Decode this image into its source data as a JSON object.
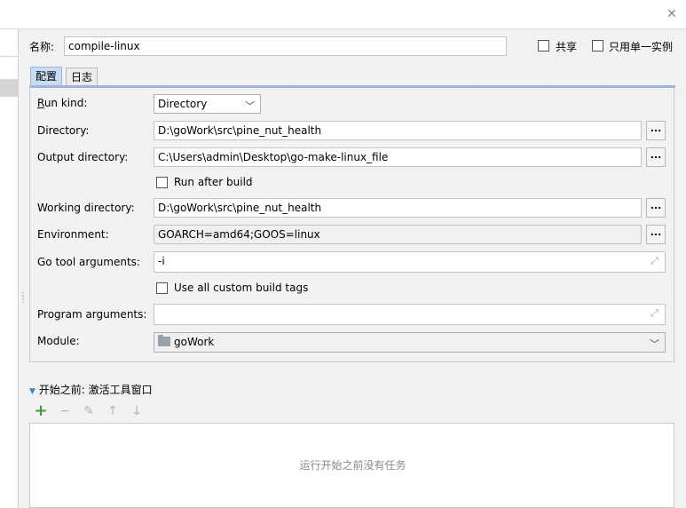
{
  "header": {
    "name_label": "名称:",
    "name_value": "compile-linux",
    "share_label": "共享",
    "single_instance_label": "只用单一实例"
  },
  "tabs": [
    {
      "label": "配置",
      "active": true
    },
    {
      "label": "日志",
      "active": false
    }
  ],
  "form": {
    "run_kind": {
      "label": "Run kind:",
      "value": "Directory"
    },
    "directory": {
      "label": "Directory:",
      "value": "D:\\goWork\\src\\pine_nut_health"
    },
    "output_directory": {
      "label": "Output directory:",
      "value": "C:\\Users\\admin\\Desktop\\go-make-linux_file"
    },
    "run_after_build": {
      "label": "Run after build",
      "checked": false
    },
    "working_directory": {
      "label": "Working directory:",
      "value": "D:\\goWork\\src\\pine_nut_health"
    },
    "environment": {
      "label": "Environment:",
      "value": "GOARCH=amd64;GOOS=linux"
    },
    "go_tool_arguments": {
      "label": "Go tool arguments:",
      "value": "-i"
    },
    "use_custom_build_tags": {
      "label": "Use all custom build tags",
      "checked": false
    },
    "program_arguments": {
      "label": "Program arguments:",
      "value": ""
    },
    "module": {
      "label": "Module:",
      "value": "goWork"
    },
    "browse_label": "..."
  },
  "before_launch": {
    "title": "开始之前: 激活工具窗口",
    "empty_text": "运行开始之前没有任务"
  },
  "colors": {
    "add_icon": "#3d9a3d",
    "tab_active": "#c7dbf2",
    "disabled_icon": "#b5b5b5"
  }
}
